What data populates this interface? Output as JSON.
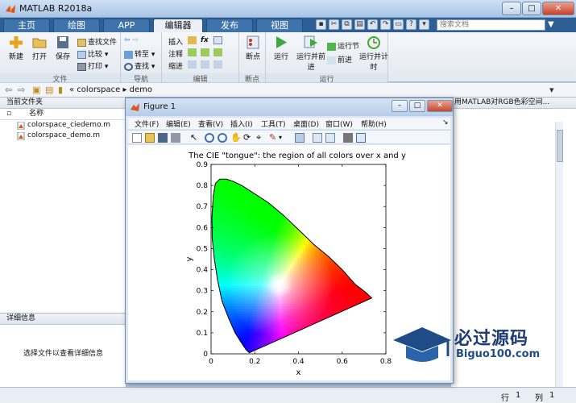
{
  "window": {
    "title": "MATLAB R2018a"
  },
  "ribbon": {
    "tabs": [
      "主页",
      "绘图",
      "APP",
      "编辑器",
      "发布",
      "视图"
    ],
    "active_tab": "编辑器",
    "search_placeholder": "搜索文档",
    "groups": {
      "file": {
        "label": "文件",
        "new": "新建",
        "open": "打开",
        "save": "保存",
        "find_files": "查找文件",
        "compare": "比较",
        "print": "打印"
      },
      "navigate": {
        "label": "导航",
        "goto": "转至",
        "find": "查找"
      },
      "edit": {
        "label": "编辑",
        "insert": "插入",
        "comment": "注释",
        "indent": "缩进",
        "fx": "fx"
      },
      "breakpoints": {
        "label": "断点",
        "breakpoints": "断点"
      },
      "run": {
        "label": "运行",
        "run": "运行",
        "run_advance": "运行并前进",
        "run_section": "运行节",
        "advance": "前进",
        "run_time": "运行并计时"
      }
    }
  },
  "address": {
    "sep": "«",
    "path1": "colorspace",
    "path2": "demo"
  },
  "current_folder": {
    "title": "当前文件夹",
    "column_name": "名称",
    "files": [
      "colorspace_ciedemo.m",
      "colorspace_demo.m"
    ],
    "details_title": "详细信息",
    "details_message": "选择文件以查看详细信息"
  },
  "right_panel": {
    "title_fragment": "用MATLAB对RGB色彩空间..."
  },
  "status": {
    "row_label": "行",
    "row": "1",
    "col_label": "列",
    "col": "1"
  },
  "figure": {
    "title": "Figure 1",
    "menus": [
      "文件(F)",
      "编辑(E)",
      "查看(V)",
      "插入(I)",
      "工具(T)",
      "桌面(D)",
      "窗口(W)",
      "帮助(H)"
    ]
  },
  "chart_data": {
    "type": "area",
    "title": "The CIE \"tongue\": the region of all colors over x and y",
    "xlabel": "x",
    "ylabel": "y",
    "xlim": [
      0,
      0.8
    ],
    "ylim": [
      0,
      0.9
    ],
    "xticks": [
      "0",
      "0.2",
      "0.4",
      "0.6",
      "0.8"
    ],
    "yticks": [
      "0",
      "0.1",
      "0.2",
      "0.3",
      "0.4",
      "0.5",
      "0.6",
      "0.7",
      "0.8",
      "0.9"
    ],
    "grid": false,
    "boundary": {
      "x": [
        0.175,
        0.17,
        0.16,
        0.14,
        0.11,
        0.08,
        0.05,
        0.03,
        0.015,
        0.005,
        0.004,
        0.01,
        0.02,
        0.04,
        0.07,
        0.1,
        0.14,
        0.2,
        0.26,
        0.33,
        0.4,
        0.47,
        0.54,
        0.6,
        0.66,
        0.71,
        0.735,
        0.175
      ],
      "y": [
        0.005,
        0.01,
        0.02,
        0.05,
        0.1,
        0.17,
        0.25,
        0.35,
        0.45,
        0.55,
        0.65,
        0.75,
        0.81,
        0.83,
        0.83,
        0.82,
        0.8,
        0.76,
        0.72,
        0.66,
        0.59,
        0.52,
        0.46,
        0.4,
        0.33,
        0.29,
        0.265,
        0.005
      ]
    },
    "white_point": [
      0.313,
      0.329
    ]
  },
  "watermark": {
    "cn": "必过源码",
    "en": "Biguo100.com"
  },
  "colors": {
    "ribbon_tab_bg": "#2d5f94",
    "active_tab": "#eaf0f6",
    "watermark": "#1d3b73"
  }
}
